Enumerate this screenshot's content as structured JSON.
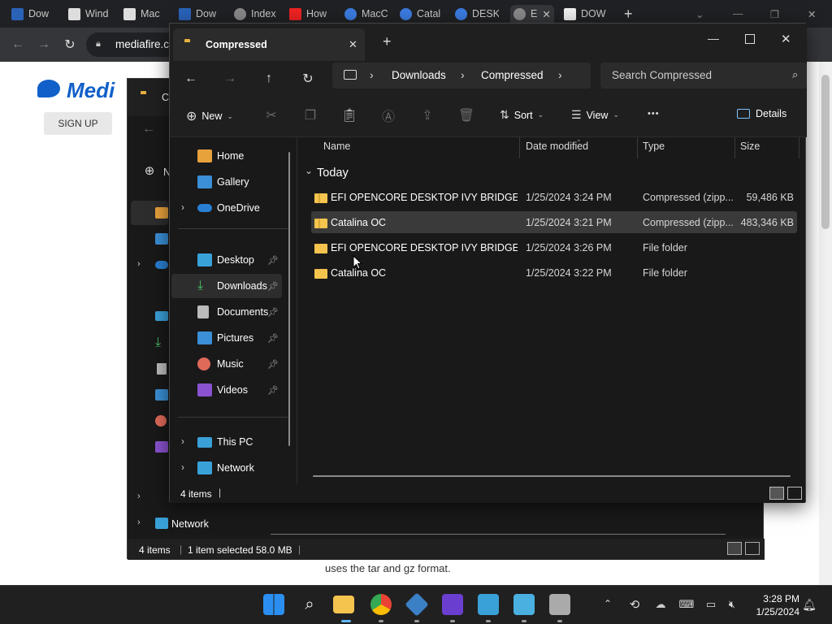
{
  "chrome": {
    "tabs": [
      "Dow",
      "Wind",
      "Mac",
      "Dow",
      "Index",
      "How",
      "MacC",
      "Catal",
      "DESK",
      "E",
      "DOW"
    ],
    "url": "mediafire.c"
  },
  "website": {
    "logo": "Medi",
    "signup": "SIGN UP",
    "body_text": "uses the tar and gz format."
  },
  "back_explorer": {
    "title": "C",
    "new_label": "N",
    "nav": [
      "Network"
    ],
    "status": {
      "items": "4 items",
      "selected": "1 item selected",
      "size": "58.0 MB"
    }
  },
  "explorer": {
    "tab_title": "Compressed",
    "breadcrumb": [
      "Downloads",
      "Compressed"
    ],
    "search_placeholder": "Search Compressed",
    "toolbar": {
      "new": "New",
      "sort": "Sort",
      "view": "View",
      "details": "Details",
      "more": "•••"
    },
    "sidebar": {
      "home": "Home",
      "gallery": "Gallery",
      "onedrive": "OneDrive",
      "desktop": "Desktop",
      "downloads": "Downloads",
      "documents": "Documents",
      "pictures": "Pictures",
      "music": "Music",
      "videos": "Videos",
      "thispc": "This PC",
      "network": "Network"
    },
    "columns": {
      "name": "Name",
      "date": "Date modified",
      "type": "Type",
      "size": "Size"
    },
    "group": "Today",
    "files": [
      {
        "name": "EFI OPENCORE DESKTOP IVY BRIDGE",
        "date": "1/25/2024 3:24 PM",
        "type": "Compressed (zipp...",
        "size": "59,486 KB",
        "kind": "zip"
      },
      {
        "name": "Catalina OC",
        "date": "1/25/2024 3:21 PM",
        "type": "Compressed (zipp...",
        "size": "483,346 KB",
        "kind": "zip",
        "selected": true
      },
      {
        "name": "EFI OPENCORE DESKTOP IVY BRIDGE",
        "date": "1/25/2024 3:26 PM",
        "type": "File folder",
        "size": "",
        "kind": "folder"
      },
      {
        "name": "Catalina OC",
        "date": "1/25/2024 3:22 PM",
        "type": "File folder",
        "size": "",
        "kind": "folder"
      }
    ],
    "status": "4 items"
  },
  "taskbar": {
    "time": "3:28 PM",
    "date": "1/25/2024"
  },
  "colors": {
    "accent": "#0078d4",
    "selection": "#3a3a3a",
    "folder": "#f4c44e"
  }
}
